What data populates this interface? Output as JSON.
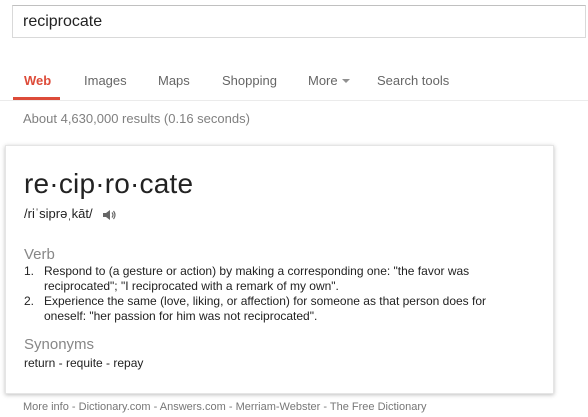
{
  "search": {
    "query": "reciprocate"
  },
  "tabs": [
    {
      "label": "Web",
      "active": true
    },
    {
      "label": "Images"
    },
    {
      "label": "Maps"
    },
    {
      "label": "Shopping"
    },
    {
      "label": "More"
    },
    {
      "label": "Search tools"
    }
  ],
  "result_stats": "About 4,630,000 results (0.16 seconds)",
  "dictionary": {
    "word": "re·cip·ro·cate",
    "pronunciation": "/riˈsiprəˌkāt/",
    "speaker_icon": "speaker-icon",
    "part_of_speech": "Verb",
    "definitions": [
      {
        "number": "1.",
        "text": "Respond to (a gesture or action) by making a corresponding one: \"the favor was reciprocated\"; \"I reciprocated with a remark of my own\"."
      },
      {
        "number": "2.",
        "text": "Experience the same (love, liking, or affection) for someone as that person does for oneself: \"her passion for him was not reciprocated\"."
      }
    ],
    "synonyms_heading": "Synonyms",
    "synonyms": "return - requite - repay"
  },
  "sources": {
    "more_info": "More info",
    "sep1": " - ",
    "dictionary_com": "Dictionary.com",
    "sep2": " - ",
    "answers_com": "Answers.com",
    "sep3": " - ",
    "merriam_webster": "Merriam-Webster",
    "sep4": " - ",
    "free_dictionary": "The Free Dictionary"
  },
  "colors": {
    "active_tab": "#dd4b39",
    "muted_text": "#808080",
    "heading_gray": "#878787"
  }
}
